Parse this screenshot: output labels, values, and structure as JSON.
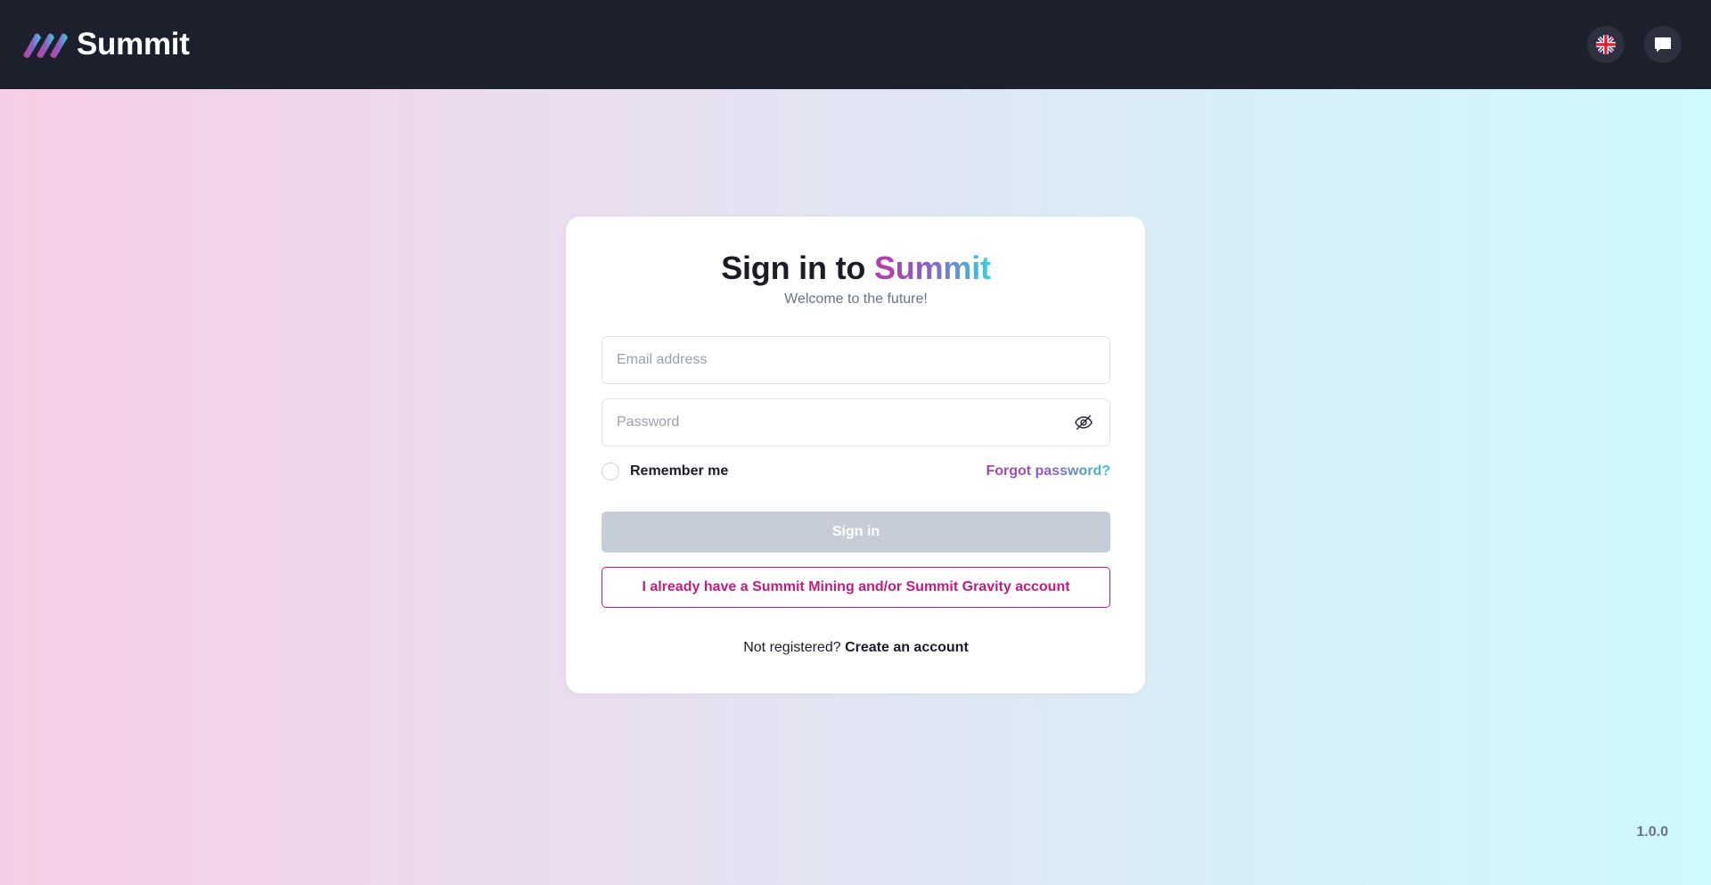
{
  "header": {
    "brand_name": "Summit",
    "logo_icon": "summit-logo-icon",
    "language_icon": "uk-flag-icon",
    "chat_icon": "chat-bubble-icon",
    "background_color": "#1c1f2c"
  },
  "login": {
    "title_prefix": "Sign in to",
    "title_brand": "Summit",
    "subtitle": "Welcome to the future!",
    "email_placeholder": "Email address",
    "email_value": "",
    "password_placeholder": "Password",
    "password_value": "",
    "password_toggle_icon": "eye-off-icon",
    "remember_label": "Remember me",
    "remember_checked": false,
    "forgot_label": "Forgot password?",
    "sign_in_label": "Sign in",
    "legacy_account_label": "I already have a Summit Mining and/or Summit Gravity account",
    "register_prompt": "Not registered?",
    "register_link": "Create an account"
  },
  "footer": {
    "version": "1.0.0"
  },
  "colors": {
    "accent_pink": "#c21c7e",
    "accent_purple": "#8a5fc0",
    "accent_cyan": "#35d0df",
    "disabled_button": "#c7cdd7"
  }
}
